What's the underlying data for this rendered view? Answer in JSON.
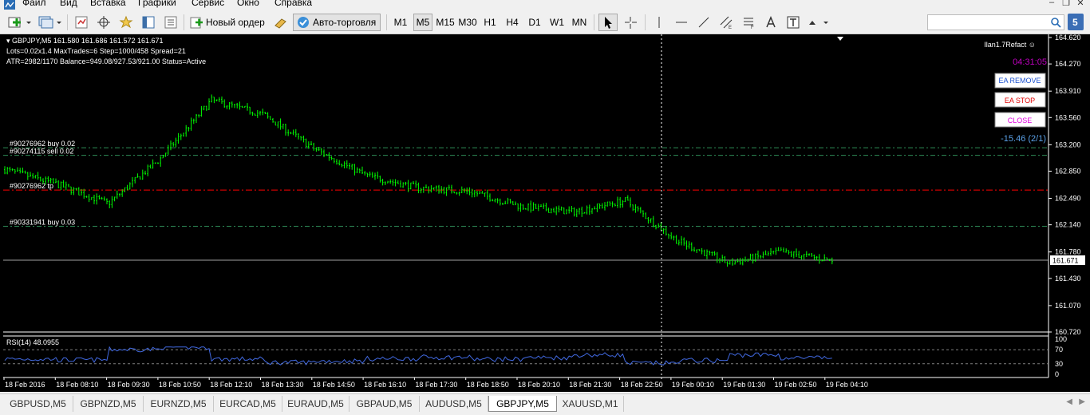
{
  "menu": {
    "items": [
      "Файл",
      "Вид",
      "Вставка",
      "Графики",
      "Сервис",
      "Окно",
      "Справка"
    ]
  },
  "toolbar": {
    "new_order_label": "Новый ордер",
    "autotrading_label": "Авто-торговля",
    "timeframes": [
      "M1",
      "M5",
      "M15",
      "M30",
      "H1",
      "H4",
      "D1",
      "W1",
      "MN"
    ],
    "active_timeframe": "M5"
  },
  "chart": {
    "header_line1": "GBPJPY,M5  161.580 161.686 161.572 161.671",
    "header_line2": "Lots=0.02x1.4 MaxTrades=6 Step=1000/458 Spread=21",
    "header_line3": "ATR=2982/1170 Balance=949.08/927.53/921.00 Status=Active",
    "ea_name": "Ilan1.7Refact ☺",
    "timer": "04:31:05",
    "btn_ea_remove": "EA REMOVE",
    "btn_ea_stop": "EA STOP",
    "btn_close": "CLOSE",
    "profit": "-15.46 (2/1)",
    "current_price": "161.671",
    "order_labels": [
      {
        "text": "#90276962 buy 0.02",
        "price": 163.16
      },
      {
        "text": "#90274115 sell 0.02",
        "price": 163.06
      },
      {
        "text": "#90276962 tp",
        "price": 162.6
      },
      {
        "text": "#90331941 buy 0.03",
        "price": 162.12
      }
    ],
    "price_ticks": [
      "164.620",
      "164.270",
      "163.910",
      "163.560",
      "163.200",
      "162.850",
      "162.490",
      "162.140",
      "161.780",
      "161.430",
      "161.070",
      "160.720"
    ],
    "rsi_label": "RSI(14) 48.0955",
    "rsi_ticks": [
      "100",
      "70",
      "30",
      "0"
    ],
    "time_ticks": [
      "18 Feb 2016",
      "18 Feb 08:10",
      "18 Feb 09:30",
      "18 Feb 10:50",
      "18 Feb 12:10",
      "18 Feb 13:30",
      "18 Feb 14:50",
      "18 Feb 16:10",
      "18 Feb 17:30",
      "18 Feb 18:50",
      "18 Feb 20:10",
      "18 Feb 21:30",
      "18 Feb 22:50",
      "19 Feb 00:10",
      "19 Feb 01:30",
      "19 Feb 02:50",
      "19 Feb 04:10"
    ],
    "colors": {
      "bg": "#000000",
      "candles": "#00ff00",
      "buy_level": "#2e8b57",
      "tp_level": "#ff0000",
      "rsi_line": "#4169e1",
      "timer": "#c000c0",
      "profit": "#5aa0e6",
      "crosshair": "#ffffff"
    }
  },
  "chart_data": {
    "type": "line",
    "title": "GBPJPY,M5",
    "ylim": [
      160.72,
      164.62
    ],
    "x": [
      "18 Feb 2016",
      "18 Feb 08:10",
      "18 Feb 09:30",
      "18 Feb 10:50",
      "18 Feb 12:10",
      "18 Feb 13:30",
      "18 Feb 14:50",
      "18 Feb 16:10",
      "18 Feb 17:30",
      "18 Feb 18:50",
      "18 Feb 20:10",
      "18 Feb 21:30",
      "18 Feb 22:50",
      "19 Feb 00:10",
      "19 Feb 01:30",
      "19 Feb 02:50",
      "19 Feb 04:10"
    ],
    "series": [
      {
        "name": "GBPJPY",
        "values": [
          162.87,
          162.68,
          162.42,
          163.01,
          163.79,
          163.6,
          163.14,
          162.79,
          162.63,
          162.58,
          162.38,
          162.31,
          162.46,
          161.93,
          161.63,
          161.78,
          161.67
        ]
      }
    ]
  },
  "tabs": {
    "items": [
      "GBPUSD,M5",
      "GBPNZD,M5",
      "EURNZD,M5",
      "EURCAD,M5",
      "EURAUD,M5",
      "GBPAUD,M5",
      "AUDUSD,M5",
      "GBPJPY,M5",
      "XAUUSD,M1"
    ],
    "active": "GBPJPY,M5"
  }
}
